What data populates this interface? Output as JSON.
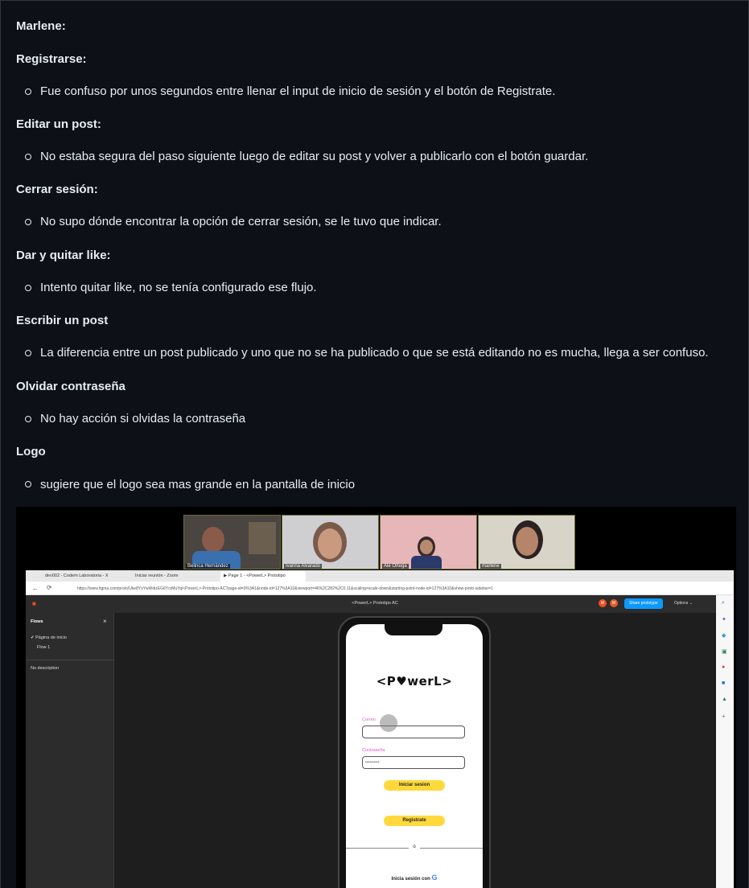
{
  "notes": {
    "title": "Marlene:",
    "sections": [
      {
        "heading": "Registrarse:",
        "bullet": "Fue confuso por unos segundos entre llenar el input de inicio de sesión y el botón de Registrate."
      },
      {
        "heading": "Editar un post:",
        "bullet": "No estaba segura del paso siguiente luego de editar su post y volver a publicarlo con el botón guardar."
      },
      {
        "heading": "Cerrar sesión:",
        "bullet": "No supo dónde encontrar la opción de cerrar sesión, se le tuvo que indicar."
      },
      {
        "heading": "Dar y quitar like:",
        "bullet": "Intento quitar like, no se tenía configurado ese flujo."
      },
      {
        "heading": "Escribir un post",
        "bullet": "La diferencia entre un post publicado y uno que no se ha publicado o que se está editando no es mucha, llega a ser confuso."
      },
      {
        "heading": "Olvidar contraseña",
        "bullet": "No hay acción si olvidas la contraseña"
      },
      {
        "heading": "Logo",
        "bullet": "sugiere que el logo sea mas grande en la pantalla de inicio"
      }
    ]
  },
  "screenshot": {
    "participants": [
      "Belinca Hernández",
      "Ivanna Alvarado",
      "Ale Ortega",
      "marlene"
    ],
    "browser": {
      "tabs": [
        "dev002 - Codem Laboratoria - X",
        "Iniciar reunión - Zoom",
        "▶ Page 1 - <PowerL> Prototipo"
      ],
      "url": "https://www.figma.com/proto/Uke8YsYwWdizEG6YcrMuYq/<PowerL>-Prototipo-AC?page-id=0%3A1&node-id=127%3A10&viewport=46%2C282%2C0.11&scaling=scale-down&starting-point-node-id=127%3A10&show-proto-sidebar=1"
    },
    "figma": {
      "file_title": "<PowerL> Prototipo AC",
      "share_label": "Share prototype",
      "options_label": "Options ⌄",
      "sidebar_title": "Flows",
      "flow_page": "Página de inicio",
      "flow_item": "Flow 1",
      "description": "No description",
      "avatars": [
        "M",
        "M"
      ]
    },
    "app": {
      "logo": "<P♥werL>",
      "email_label": "Correo",
      "password_label": "Contraseña",
      "password_value": "••••••••••",
      "login_button": "Iniciar sesion",
      "register_button": "Registrate",
      "divider": "o",
      "google_label": "Inicia sesión con"
    }
  }
}
